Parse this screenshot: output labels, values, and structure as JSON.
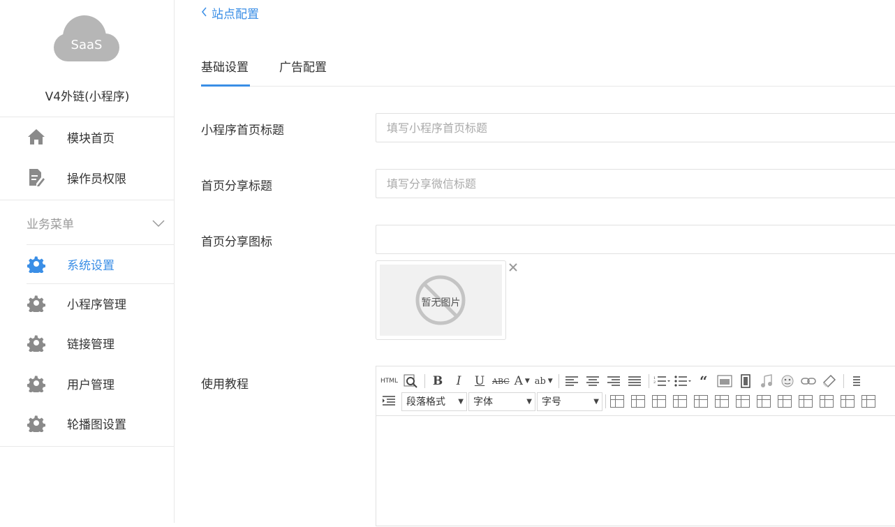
{
  "sidebar": {
    "logo_text": "SaaS",
    "app_name": "V4外链(小程序)",
    "top_items": [
      {
        "label": "模块首页",
        "icon": "home-icon"
      },
      {
        "label": "操作员权限",
        "icon": "document-edit-icon"
      }
    ],
    "section": {
      "label": "业务菜单",
      "icon": "chevron-down-icon"
    },
    "menu_items": [
      {
        "label": "系统设置",
        "icon": "gear-icon",
        "active": true
      },
      {
        "label": "小程序管理",
        "icon": "gear-icon"
      },
      {
        "label": "链接管理",
        "icon": "gear-icon"
      },
      {
        "label": "用户管理",
        "icon": "gear-icon"
      },
      {
        "label": "轮播图设置",
        "icon": "gear-icon"
      }
    ]
  },
  "header": {
    "back_label": "站点配置"
  },
  "tabs": [
    {
      "label": "基础设置",
      "active": true
    },
    {
      "label": "广告配置"
    }
  ],
  "form": {
    "title": {
      "label": "小程序首页标题",
      "placeholder": "填写小程序首页标题",
      "value": ""
    },
    "share_title": {
      "label": "首页分享标题",
      "placeholder": "填写分享微信标题",
      "value": ""
    },
    "share_icon": {
      "label": "首页分享图标",
      "value": "",
      "no_image_text": "暂无图片"
    },
    "tutorial": {
      "label": "使用教程",
      "toolbar": {
        "html_label": "HTML",
        "bold": "B",
        "italic": "I",
        "underline": "U",
        "strike": "ABC",
        "fontcolor": "A",
        "format": "ab",
        "paragraph": "段落格式",
        "font": "字体",
        "fontsize": "字号"
      }
    }
  },
  "colors": {
    "accent": "#3a8ee6",
    "icon_gray": "#8a8a8a",
    "logo_gray": "#b6b6b6"
  }
}
